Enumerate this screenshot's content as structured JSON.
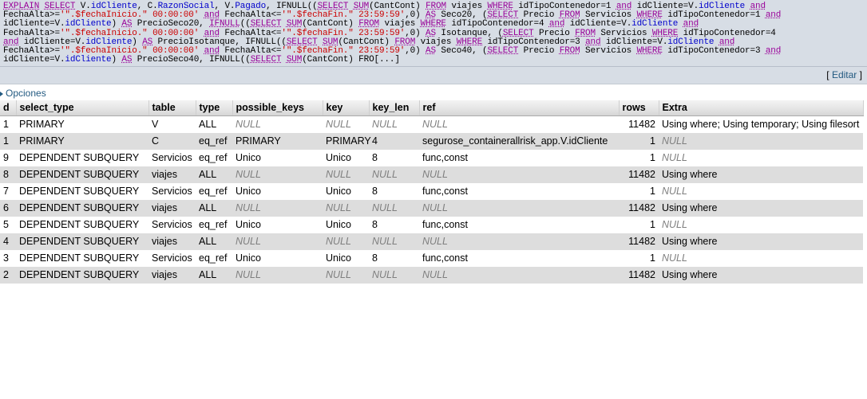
{
  "sql": {
    "tokens": [
      {
        "t": "EXPLAIN",
        "c": "kw"
      },
      {
        "t": " ",
        "c": "plain"
      },
      {
        "t": "SELECT",
        "c": "kw"
      },
      {
        "t": " ",
        "c": "plain"
      },
      {
        "t": "V.",
        "c": "plain"
      },
      {
        "t": "idCliente",
        "c": "id"
      },
      {
        "t": ", ",
        "c": "plain"
      },
      {
        "t": "C.",
        "c": "plain"
      },
      {
        "t": "RazonSocial",
        "c": "id"
      },
      {
        "t": ", ",
        "c": "plain"
      },
      {
        "t": "V.",
        "c": "plain"
      },
      {
        "t": "Pagado",
        "c": "id"
      },
      {
        "t": ", ",
        "c": "plain"
      },
      {
        "t": "IFNULL((",
        "c": "plain"
      },
      {
        "t": "SELECT",
        "c": "kw"
      },
      {
        "t": " ",
        "c": "plain"
      },
      {
        "t": "SUM",
        "c": "fn"
      },
      {
        "t": "(CantCont) ",
        "c": "plain"
      },
      {
        "t": "FROM",
        "c": "kw"
      },
      {
        "t": " viajes ",
        "c": "plain"
      },
      {
        "t": "WHERE",
        "c": "kw"
      },
      {
        "t": " idTipoContenedor=1 ",
        "c": "plain"
      },
      {
        "t": "and",
        "c": "kw"
      },
      {
        "t": " idCliente=V.",
        "c": "plain"
      },
      {
        "t": "idCliente",
        "c": "id"
      },
      {
        "t": " ",
        "c": "plain"
      },
      {
        "t": "and",
        "c": "kw"
      },
      {
        "t": "\nFechaAlta>=",
        "c": "plain"
      },
      {
        "t": "'\".$fechaInicio.\" 00:00:00'",
        "c": "str"
      },
      {
        "t": " ",
        "c": "plain"
      },
      {
        "t": "and",
        "c": "kw"
      },
      {
        "t": " FechaAlta<=",
        "c": "plain"
      },
      {
        "t": "'\".$fechaFin.\" 23:59:59'",
        "c": "str"
      },
      {
        "t": ",0) ",
        "c": "plain"
      },
      {
        "t": "AS",
        "c": "kw"
      },
      {
        "t": " Seco20, (",
        "c": "plain"
      },
      {
        "t": "SELECT",
        "c": "kw"
      },
      {
        "t": " Precio ",
        "c": "plain"
      },
      {
        "t": "FROM",
        "c": "kw"
      },
      {
        "t": " Servicios ",
        "c": "plain"
      },
      {
        "t": "WHERE",
        "c": "kw"
      },
      {
        "t": " idTipoContenedor=1 ",
        "c": "plain"
      },
      {
        "t": "and",
        "c": "kw"
      },
      {
        "t": "\nidCliente=V.",
        "c": "plain"
      },
      {
        "t": "idCliente",
        "c": "id"
      },
      {
        "t": ") ",
        "c": "plain"
      },
      {
        "t": "AS",
        "c": "kw"
      },
      {
        "t": " PrecioSeco20, ",
        "c": "plain"
      },
      {
        "t": "IFNULL",
        "c": "fn"
      },
      {
        "t": "((",
        "c": "plain"
      },
      {
        "t": "SELECT",
        "c": "kw"
      },
      {
        "t": " ",
        "c": "plain"
      },
      {
        "t": "SUM",
        "c": "fn"
      },
      {
        "t": "(CantCont) ",
        "c": "plain"
      },
      {
        "t": "FROM",
        "c": "kw"
      },
      {
        "t": " viajes ",
        "c": "plain"
      },
      {
        "t": "WHERE",
        "c": "kw"
      },
      {
        "t": " idTipoContenedor=4 ",
        "c": "plain"
      },
      {
        "t": "and",
        "c": "kw"
      },
      {
        "t": " idCliente=V.",
        "c": "plain"
      },
      {
        "t": "idCliente",
        "c": "id"
      },
      {
        "t": " ",
        "c": "plain"
      },
      {
        "t": "and",
        "c": "kw"
      },
      {
        "t": "\nFechaAlta>=",
        "c": "plain"
      },
      {
        "t": "'\".$fechaInicio.\" 00:00:00'",
        "c": "str"
      },
      {
        "t": " ",
        "c": "plain"
      },
      {
        "t": "and",
        "c": "kw"
      },
      {
        "t": " FechaAlta<=",
        "c": "plain"
      },
      {
        "t": "'\".$fechaFin.\" 23:59:59'",
        "c": "str"
      },
      {
        "t": ",0) ",
        "c": "plain"
      },
      {
        "t": "AS",
        "c": "kw"
      },
      {
        "t": " Isotanque, (",
        "c": "plain"
      },
      {
        "t": "SELECT",
        "c": "kw"
      },
      {
        "t": " Precio ",
        "c": "plain"
      },
      {
        "t": "FROM",
        "c": "kw"
      },
      {
        "t": " Servicios ",
        "c": "plain"
      },
      {
        "t": "WHERE",
        "c": "kw"
      },
      {
        "t": " idTipoContenedor=4\n",
        "c": "plain"
      },
      {
        "t": "and",
        "c": "kw"
      },
      {
        "t": " idCliente=V.",
        "c": "plain"
      },
      {
        "t": "idCliente",
        "c": "id"
      },
      {
        "t": ") ",
        "c": "plain"
      },
      {
        "t": "AS",
        "c": "kw"
      },
      {
        "t": " PrecioIsotanque, ",
        "c": "plain"
      },
      {
        "t": "IFNULL((",
        "c": "plain"
      },
      {
        "t": "SELECT",
        "c": "kw"
      },
      {
        "t": " ",
        "c": "plain"
      },
      {
        "t": "SUM",
        "c": "fn"
      },
      {
        "t": "(CantCont) ",
        "c": "plain"
      },
      {
        "t": "FROM",
        "c": "kw"
      },
      {
        "t": " viajes ",
        "c": "plain"
      },
      {
        "t": "WHERE",
        "c": "kw"
      },
      {
        "t": " idTipoContenedor=3 ",
        "c": "plain"
      },
      {
        "t": "and",
        "c": "kw"
      },
      {
        "t": " idCliente=V.",
        "c": "plain"
      },
      {
        "t": "idCliente",
        "c": "id"
      },
      {
        "t": " ",
        "c": "plain"
      },
      {
        "t": "and",
        "c": "kw"
      },
      {
        "t": "\nFechaAlta>=",
        "c": "plain"
      },
      {
        "t": "'\".$fechaInicio.\" 00:00:00'",
        "c": "str"
      },
      {
        "t": " ",
        "c": "plain"
      },
      {
        "t": "and",
        "c": "kw"
      },
      {
        "t": " FechaAlta<=",
        "c": "plain"
      },
      {
        "t": "'\".$fechaFin.\" 23:59:59'",
        "c": "str"
      },
      {
        "t": ",0) ",
        "c": "plain"
      },
      {
        "t": "AS",
        "c": "kw"
      },
      {
        "t": " Seco40, (",
        "c": "plain"
      },
      {
        "t": "SELECT",
        "c": "kw"
      },
      {
        "t": " Precio ",
        "c": "plain"
      },
      {
        "t": "FROM",
        "c": "kw"
      },
      {
        "t": " Servicios ",
        "c": "plain"
      },
      {
        "t": "WHERE",
        "c": "kw"
      },
      {
        "t": " idTipoContenedor=3 ",
        "c": "plain"
      },
      {
        "t": "and",
        "c": "kw"
      },
      {
        "t": "\nidCliente=V.",
        "c": "plain"
      },
      {
        "t": "idCliente",
        "c": "id"
      },
      {
        "t": ") ",
        "c": "plain"
      },
      {
        "t": "AS",
        "c": "kw"
      },
      {
        "t": " PrecioSeco40, ",
        "c": "plain"
      },
      {
        "t": "IFNULL((",
        "c": "plain"
      },
      {
        "t": "SELECT",
        "c": "kw"
      },
      {
        "t": " ",
        "c": "plain"
      },
      {
        "t": "SUM",
        "c": "fn"
      },
      {
        "t": "(CantCont) FRO[...]",
        "c": "plain"
      }
    ]
  },
  "edit": {
    "open_bracket": "[",
    "label": "Editar",
    "close_bracket": "]"
  },
  "options": {
    "label": "Opciones"
  },
  "explain_table": {
    "columns": [
      "d",
      "select_type",
      "table",
      "type",
      "possible_keys",
      "key",
      "key_len",
      "ref",
      "rows",
      "Extra"
    ],
    "rows": [
      {
        "d": "1",
        "select_type": "PRIMARY",
        "table": "V",
        "type": "ALL",
        "possible_keys": "NULL",
        "key": "NULL",
        "key_len": "NULL",
        "ref": "NULL",
        "rows": "11482",
        "extra": "Using where; Using temporary; Using filesort"
      },
      {
        "d": "1",
        "select_type": "PRIMARY",
        "table": "C",
        "type": "eq_ref",
        "possible_keys": "PRIMARY",
        "key": "PRIMARY",
        "key_len": "4",
        "ref": "segurose_containerallrisk_app.V.idCliente",
        "rows": "1",
        "extra": "NULL"
      },
      {
        "d": "9",
        "select_type": "DEPENDENT SUBQUERY",
        "table": "Servicios",
        "type": "eq_ref",
        "possible_keys": "Unico",
        "key": "Unico",
        "key_len": "8",
        "ref": "func,const",
        "rows": "1",
        "extra": "NULL"
      },
      {
        "d": "8",
        "select_type": "DEPENDENT SUBQUERY",
        "table": "viajes",
        "type": "ALL",
        "possible_keys": "NULL",
        "key": "NULL",
        "key_len": "NULL",
        "ref": "NULL",
        "rows": "11482",
        "extra": "Using where"
      },
      {
        "d": "7",
        "select_type": "DEPENDENT SUBQUERY",
        "table": "Servicios",
        "type": "eq_ref",
        "possible_keys": "Unico",
        "key": "Unico",
        "key_len": "8",
        "ref": "func,const",
        "rows": "1",
        "extra": "NULL"
      },
      {
        "d": "6",
        "select_type": "DEPENDENT SUBQUERY",
        "table": "viajes",
        "type": "ALL",
        "possible_keys": "NULL",
        "key": "NULL",
        "key_len": "NULL",
        "ref": "NULL",
        "rows": "11482",
        "extra": "Using where"
      },
      {
        "d": "5",
        "select_type": "DEPENDENT SUBQUERY",
        "table": "Servicios",
        "type": "eq_ref",
        "possible_keys": "Unico",
        "key": "Unico",
        "key_len": "8",
        "ref": "func,const",
        "rows": "1",
        "extra": "NULL"
      },
      {
        "d": "4",
        "select_type": "DEPENDENT SUBQUERY",
        "table": "viajes",
        "type": "ALL",
        "possible_keys": "NULL",
        "key": "NULL",
        "key_len": "NULL",
        "ref": "NULL",
        "rows": "11482",
        "extra": "Using where"
      },
      {
        "d": "3",
        "select_type": "DEPENDENT SUBQUERY",
        "table": "Servicios",
        "type": "eq_ref",
        "possible_keys": "Unico",
        "key": "Unico",
        "key_len": "8",
        "ref": "func,const",
        "rows": "1",
        "extra": "NULL"
      },
      {
        "d": "2",
        "select_type": "DEPENDENT SUBQUERY",
        "table": "viajes",
        "type": "ALL",
        "possible_keys": "NULL",
        "key": "NULL",
        "key_len": "NULL",
        "ref": "NULL",
        "rows": "11482",
        "extra": "Using where"
      }
    ]
  },
  "colors": {
    "sql_panel_bg": "#d7dde5",
    "keyword": "#990099",
    "identifier": "#0000cc",
    "string": "#cc0000",
    "link": "#235a81",
    "row_even_bg": "#dddddd",
    "null_text": "#7f7f7f"
  }
}
